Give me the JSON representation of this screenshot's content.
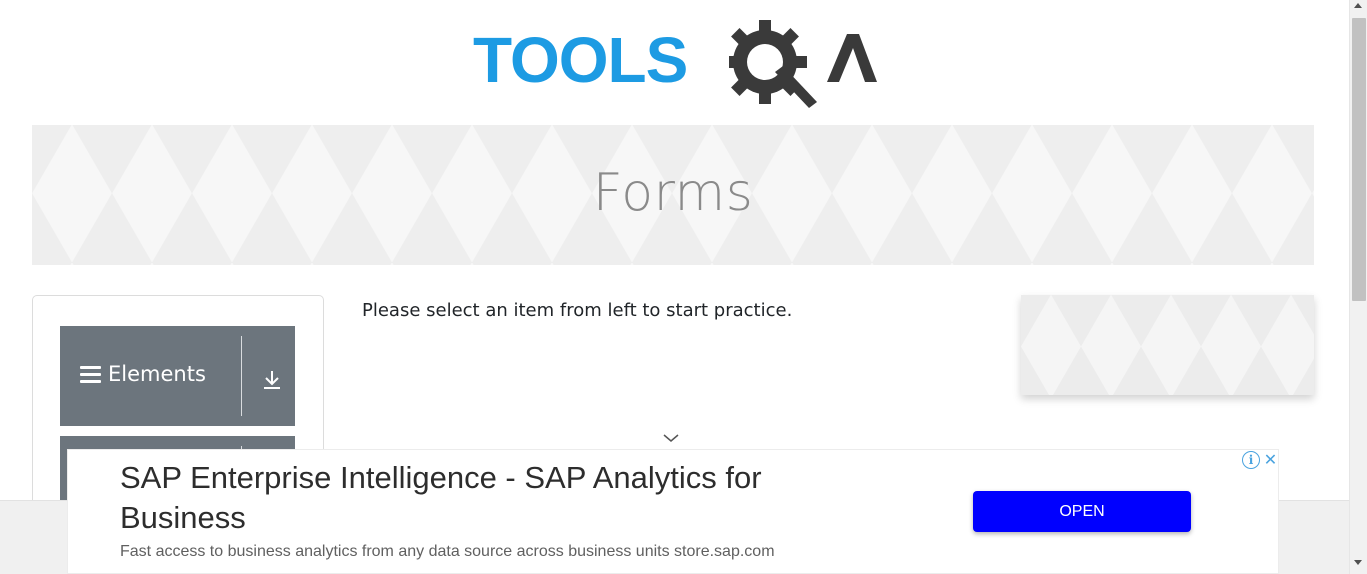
{
  "header": {
    "logo_text": "TOOLS",
    "logo_alt": "TOOLSQA",
    "logo_suffix": "A"
  },
  "banner": {
    "title": "Forms"
  },
  "sidebar": {
    "groups": [
      {
        "label": "Elements",
        "icon": "download-arrow-icon"
      },
      {
        "label": "",
        "icon": "download-arrow-icon"
      }
    ]
  },
  "main": {
    "instruction": "Please select an item from left to start practice."
  },
  "ad": {
    "title": "SAP Enterprise Intelligence - SAP Analytics for Business",
    "description": "Fast access to business analytics from any data source across business units store.sap.com",
    "cta_label": "OPEN",
    "info_icon": "info-icon",
    "close_icon": "close-icon",
    "info_glyph": "i",
    "close_glyph": "✕"
  },
  "colors": {
    "logo_blue": "#1d9be3",
    "logo_dark": "#3a3a3a",
    "sidebar_header": "#6c757d",
    "ad_button": "#0000ff"
  }
}
